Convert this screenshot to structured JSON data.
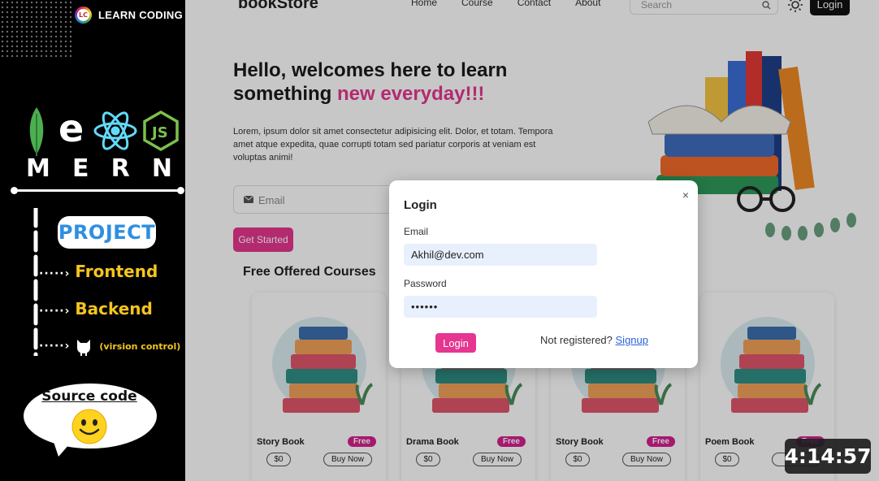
{
  "thumbnail": {
    "channel": "LEARN CODING",
    "channel_badge": "LC",
    "stack_word": [
      "M",
      "E",
      "R",
      "N"
    ],
    "project_label": "PROJECT",
    "branches": [
      "Frontend",
      "Backend",
      "(virsion control)"
    ],
    "source_code": "Source code",
    "duration": "4:14:57"
  },
  "site": {
    "brand": "bookStore",
    "nav": [
      "Home",
      "Course",
      "Contact",
      "About"
    ],
    "search_placeholder": "Search",
    "login_button": "Login",
    "hero": {
      "title_line1": "Hello, welcomes here to learn",
      "title_line2_prefix": "something ",
      "title_line2_accent": "new everyday!!!",
      "paragraph": "Lorem, ipsum dolor sit amet consectetur adipisicing elit. Dolor, et totam. Tempora amet atque expedita, quae corrupti totam sed pariatur corporis at veniam est voluptas animi!",
      "email_placeholder": "Email",
      "cta": "Get Started"
    },
    "courses_title": "Free Offered Courses",
    "cards": [
      {
        "name": "Story Book",
        "badge": "Free",
        "price": "$0",
        "action": "Buy Now"
      },
      {
        "name": "Drama Book",
        "badge": "Free",
        "price": "$0",
        "action": "Buy Now"
      },
      {
        "name": "Story Book",
        "badge": "Free",
        "price": "$0",
        "action": "Buy Now"
      },
      {
        "name": "Poem Book",
        "badge": "Free",
        "price": "$0",
        "action": "Bu"
      }
    ]
  },
  "modal": {
    "title": "Login",
    "close": "×",
    "email_label": "Email",
    "email_value": "Akhil@dev.com",
    "password_label": "Password",
    "password_value": "••••••",
    "submit": "Login",
    "not_registered": "Not registered?",
    "signup": "Signup"
  },
  "colors": {
    "accent": "#e6368f",
    "badge": "#d61f8f",
    "link": "#2a63d6",
    "frontend_text": "#f4c51e",
    "project_text": "#2f8fe0"
  }
}
